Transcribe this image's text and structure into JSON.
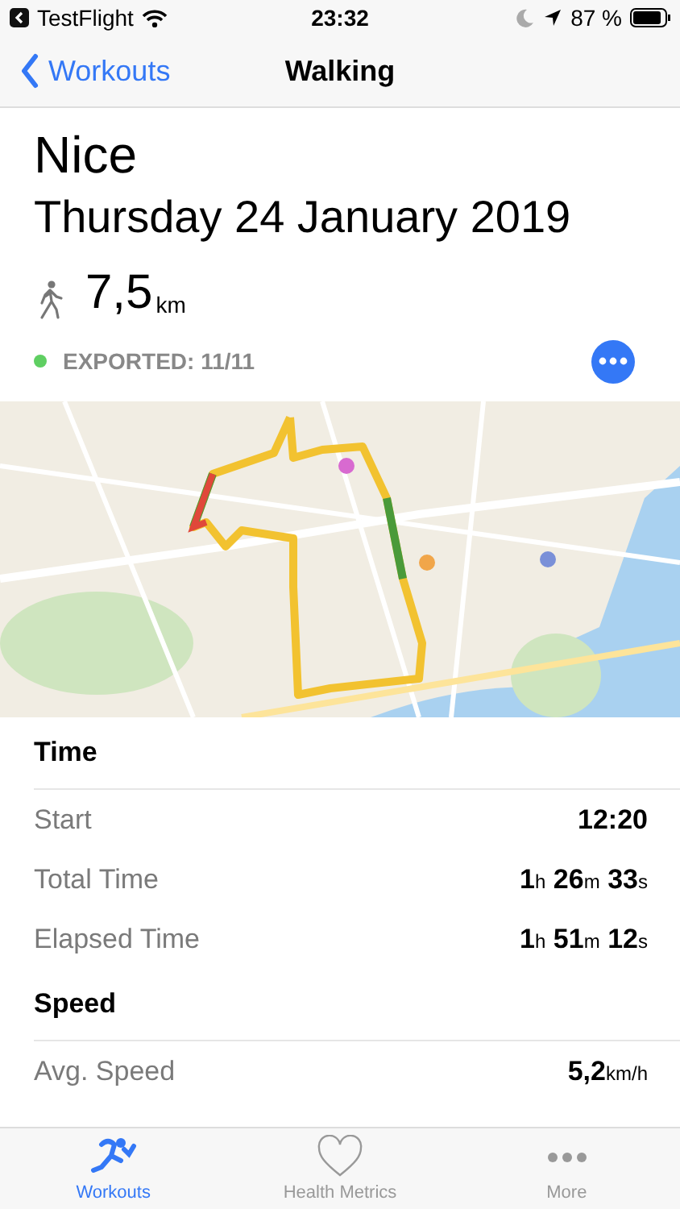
{
  "status_bar": {
    "app": "TestFlight",
    "time": "23:32",
    "battery": "87 %"
  },
  "nav": {
    "back": "Workouts",
    "title": "Walking"
  },
  "workout": {
    "place": "Nice",
    "date": "Thursday 24 January 2019",
    "distance": "7,5",
    "distance_unit": "km"
  },
  "export": {
    "label": "EXPORTED: 11/11",
    "color": "#5fcf62"
  },
  "sections": [
    {
      "title": "Time",
      "rows": [
        {
          "label": "Start",
          "value": [
            {
              "num": "12:20"
            }
          ]
        },
        {
          "label": "Total Time",
          "value": [
            {
              "num": "1",
              "unit": "h"
            },
            {
              "num": "26",
              "unit": "m"
            },
            {
              "num": "33",
              "unit": "s"
            }
          ]
        },
        {
          "label": "Elapsed Time",
          "value": [
            {
              "num": "1",
              "unit": "h"
            },
            {
              "num": "51",
              "unit": "m"
            },
            {
              "num": "12",
              "unit": "s"
            }
          ]
        }
      ]
    },
    {
      "title": "Speed",
      "rows": [
        {
          "label": "Avg. Speed",
          "value": [
            {
              "num": "5,2",
              "unit": "km/h"
            }
          ]
        }
      ]
    }
  ],
  "tabs": [
    {
      "label": "Workouts",
      "kind": "runner",
      "selected": true
    },
    {
      "label": "Health Metrics",
      "kind": "heart",
      "selected": false
    },
    {
      "label": "More",
      "kind": "dots",
      "selected": false
    }
  ]
}
